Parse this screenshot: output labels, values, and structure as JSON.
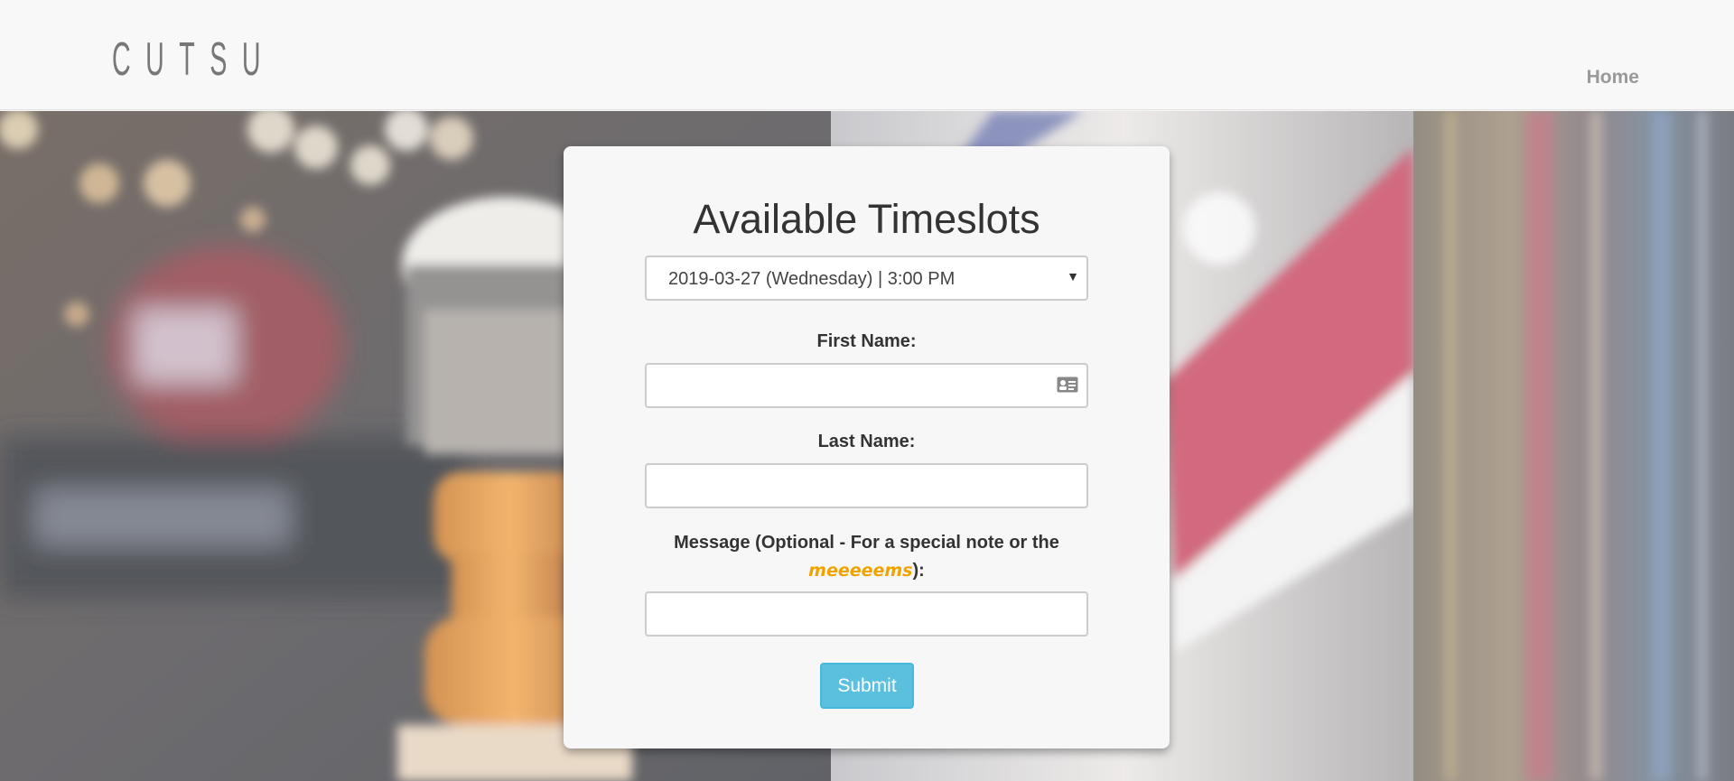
{
  "navbar": {
    "brand": "CUTSU",
    "home_label": "Home"
  },
  "form": {
    "title": "Available Timeslots",
    "timeslot_selected": "2019-03-27 (Wednesday) | 3:00 PM",
    "first_name_label": "First Name:",
    "first_name_value": "",
    "last_name_label": "Last Name:",
    "last_name_value": "",
    "message_label_prefix": "Message (Optional - For a special note or the ",
    "message_label_highlight": "meeeeems",
    "message_label_suffix": "):",
    "message_value": "",
    "submit_label": "Submit"
  },
  "colors": {
    "accent_button": "#5bc0de",
    "highlight_text": "#f0a300"
  },
  "icons": {
    "caret": "caret-down-icon",
    "contact_card": "contact-card-icon"
  }
}
